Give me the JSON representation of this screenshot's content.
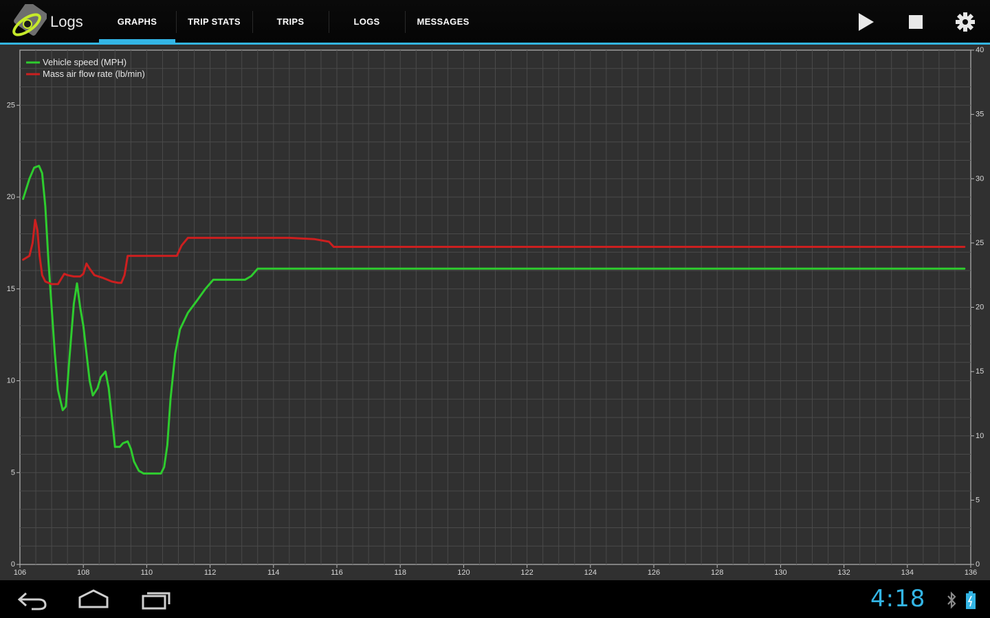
{
  "actionbar": {
    "title": "Logs",
    "tabs": [
      {
        "label": "GRAPHS",
        "selected": true
      },
      {
        "label": "TRIP STATS",
        "selected": false
      },
      {
        "label": "TRIPS",
        "selected": false
      },
      {
        "label": "LOGS",
        "selected": false
      },
      {
        "label": "MESSAGES",
        "selected": false
      }
    ],
    "actions": [
      "play-icon",
      "stop-icon",
      "gear-icon"
    ]
  },
  "colors": {
    "accent": "#33b5e5",
    "speed_series": "#2ecc2e",
    "maf_series": "#cc1f1f",
    "plot_bg": "#303030",
    "grid": "#4a4a4a"
  },
  "navbar": {
    "buttons": [
      "back-icon",
      "home-icon",
      "recent-apps-icon"
    ],
    "clock": "4:18",
    "status_icons": [
      "bluetooth-icon",
      "battery-icon"
    ]
  },
  "chart_data": {
    "type": "line",
    "title": "",
    "xlabel": "",
    "ylabel": "",
    "xlim": [
      106,
      136
    ],
    "ylim_left": [
      0,
      28
    ],
    "ylim_right": [
      0,
      40
    ],
    "x_ticks": [
      "106",
      "108",
      "110",
      "112",
      "114",
      "116",
      "118",
      "120",
      "122",
      "124",
      "126",
      "128",
      "130",
      "132",
      "134",
      "136"
    ],
    "y_left_ticks": [
      "0",
      "5",
      "10",
      "15",
      "20",
      "25"
    ],
    "y_right_ticks": [
      "0",
      "5",
      "10",
      "15",
      "20",
      "25",
      "30",
      "35",
      "40"
    ],
    "grid": true,
    "legend_position": "top-left",
    "series": [
      {
        "name": "Vehicle speed (MPH)",
        "axis": "left",
        "color": "#2ecc2e",
        "points": [
          [
            106.1,
            19.9
          ],
          [
            106.3,
            21.0
          ],
          [
            106.45,
            21.6
          ],
          [
            106.6,
            21.7
          ],
          [
            106.7,
            21.3
          ],
          [
            106.8,
            19.5
          ],
          [
            106.9,
            16.5
          ],
          [
            107.0,
            14.0
          ],
          [
            107.1,
            11.5
          ],
          [
            107.2,
            9.5
          ],
          [
            107.35,
            8.4
          ],
          [
            107.45,
            8.6
          ],
          [
            107.55,
            11.0
          ],
          [
            107.7,
            14.2
          ],
          [
            107.8,
            15.3
          ],
          [
            107.9,
            14.0
          ],
          [
            108.0,
            13.0
          ],
          [
            108.1,
            11.5
          ],
          [
            108.2,
            10.0
          ],
          [
            108.3,
            9.2
          ],
          [
            108.45,
            9.6
          ],
          [
            108.55,
            10.2
          ],
          [
            108.7,
            10.5
          ],
          [
            108.8,
            9.6
          ],
          [
            108.9,
            8.0
          ],
          [
            109.0,
            6.4
          ],
          [
            109.15,
            6.4
          ],
          [
            109.25,
            6.6
          ],
          [
            109.4,
            6.7
          ],
          [
            109.5,
            6.3
          ],
          [
            109.6,
            5.6
          ],
          [
            109.75,
            5.1
          ],
          [
            109.9,
            4.95
          ],
          [
            110.2,
            4.95
          ],
          [
            110.45,
            4.95
          ],
          [
            110.55,
            5.3
          ],
          [
            110.65,
            6.5
          ],
          [
            110.75,
            9.0
          ],
          [
            110.9,
            11.5
          ],
          [
            111.05,
            12.8
          ],
          [
            111.3,
            13.7
          ],
          [
            111.6,
            14.4
          ],
          [
            111.85,
            15.0
          ],
          [
            112.1,
            15.5
          ],
          [
            112.3,
            15.5
          ],
          [
            112.6,
            15.5
          ],
          [
            113.1,
            15.5
          ],
          [
            113.3,
            15.7
          ],
          [
            113.5,
            16.1
          ],
          [
            115.0,
            16.1
          ],
          [
            120.0,
            16.1
          ],
          [
            125.0,
            16.1
          ],
          [
            130.0,
            16.1
          ],
          [
            135.8,
            16.1
          ]
        ]
      },
      {
        "name": "Mass air flow rate (lb/min)",
        "axis": "right",
        "color": "#cc1f1f",
        "points": [
          [
            106.1,
            23.7
          ],
          [
            106.3,
            24.0
          ],
          [
            106.4,
            25.0
          ],
          [
            106.48,
            26.8
          ],
          [
            106.55,
            26.0
          ],
          [
            106.62,
            24.0
          ],
          [
            106.7,
            22.5
          ],
          [
            106.8,
            22.0
          ],
          [
            107.0,
            21.8
          ],
          [
            107.2,
            21.8
          ],
          [
            107.3,
            22.2
          ],
          [
            107.4,
            22.6
          ],
          [
            107.5,
            22.5
          ],
          [
            107.7,
            22.4
          ],
          [
            107.9,
            22.4
          ],
          [
            108.0,
            22.6
          ],
          [
            108.1,
            23.4
          ],
          [
            108.2,
            23.0
          ],
          [
            108.35,
            22.5
          ],
          [
            108.6,
            22.3
          ],
          [
            108.9,
            22.0
          ],
          [
            109.1,
            21.9
          ],
          [
            109.2,
            21.9
          ],
          [
            109.3,
            22.5
          ],
          [
            109.4,
            24.0
          ],
          [
            109.5,
            24.0
          ],
          [
            110.0,
            24.0
          ],
          [
            110.5,
            24.0
          ],
          [
            110.95,
            24.0
          ],
          [
            111.1,
            24.8
          ],
          [
            111.3,
            25.4
          ],
          [
            111.6,
            25.4
          ],
          [
            112.0,
            25.4
          ],
          [
            113.0,
            25.4
          ],
          [
            114.5,
            25.4
          ],
          [
            115.3,
            25.3
          ],
          [
            115.75,
            25.1
          ],
          [
            115.9,
            24.7
          ],
          [
            116.5,
            24.7
          ],
          [
            120.0,
            24.7
          ],
          [
            125.0,
            24.7
          ],
          [
            130.0,
            24.7
          ],
          [
            135.8,
            24.7
          ]
        ]
      }
    ]
  }
}
